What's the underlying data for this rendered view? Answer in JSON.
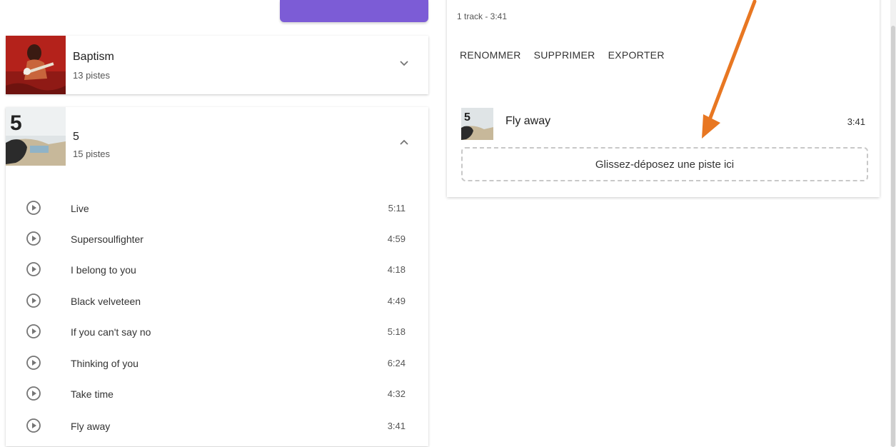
{
  "albums": [
    {
      "title": "Baptism",
      "subtitle": "13 pistes",
      "expanded": false
    },
    {
      "title": "5",
      "subtitle": "15 pistes",
      "expanded": true
    }
  ],
  "tracks": [
    {
      "title": "Live",
      "duration": "5:11"
    },
    {
      "title": "Supersoulfighter",
      "duration": "4:59"
    },
    {
      "title": "I belong to you",
      "duration": "4:18"
    },
    {
      "title": "Black velveteen",
      "duration": "4:49"
    },
    {
      "title": "If you can't say no",
      "duration": "5:18"
    },
    {
      "title": "Thinking of you",
      "duration": "6:24"
    },
    {
      "title": "Take time",
      "duration": "4:32"
    },
    {
      "title": "Fly away",
      "duration": "3:41"
    }
  ],
  "playlist": {
    "info": "1 track - 3:41",
    "actions": [
      "RENOMMER",
      "SUPPRIMER",
      "EXPORTER"
    ],
    "track": {
      "title": "Fly away",
      "duration": "3:41",
      "art_label": "5"
    },
    "dropzone_label": "Glissez-déposez une piste ici"
  },
  "colors": {
    "accent_purple": "#7c5cd6",
    "annotation_arrow": "#e87722"
  },
  "icons": {
    "play": "play-circle-icon",
    "collapse": "chevron-up-icon",
    "expand": "chevron-down-icon"
  }
}
